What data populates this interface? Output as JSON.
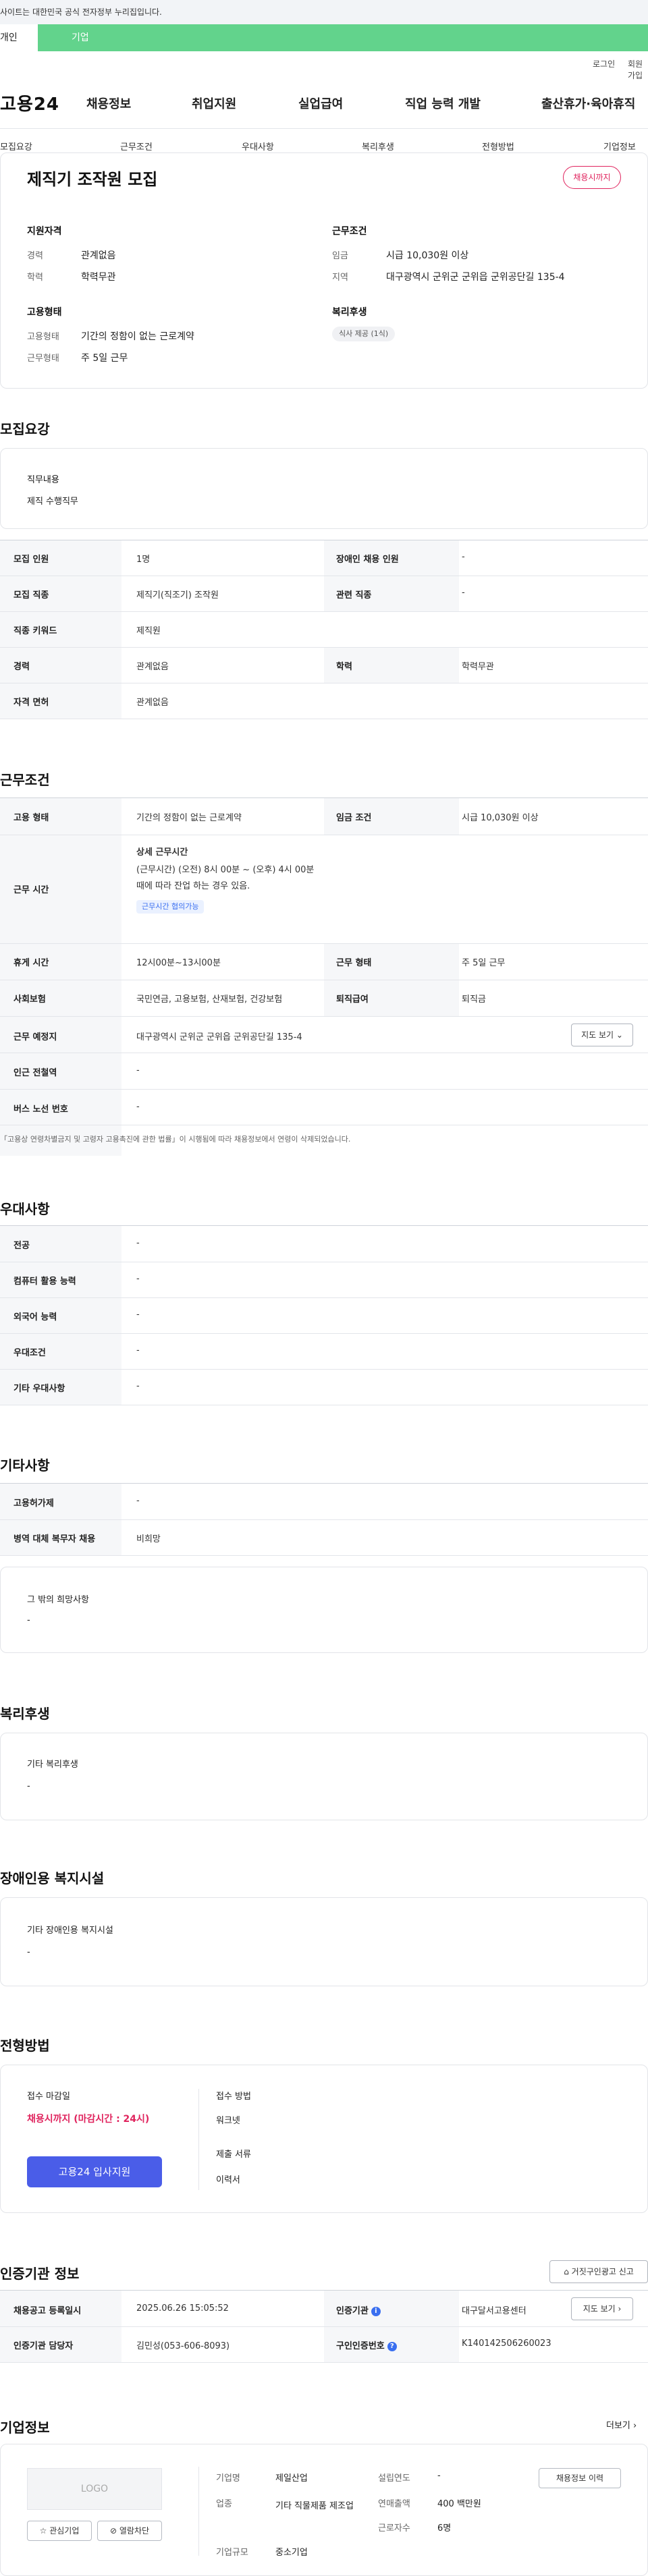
{
  "gov_bar": {
    "text": "사이트는 대한민국 공식 전자정부 누리집입니다."
  },
  "top_tabs": {
    "personal": "개인",
    "company": "기업"
  },
  "util": {
    "login": "로그인",
    "join": "회원가입"
  },
  "header": {
    "logo": "고용24",
    "gnb": [
      "채용정보",
      "취업지원",
      "실업급여",
      "직업 능력 개발",
      "출산휴가·육아휴직"
    ]
  },
  "subnav": [
    "모집요강",
    "근무조건",
    "우대사항",
    "복리후생",
    "전형방법",
    "기업정보"
  ],
  "summary": {
    "title": "제직기 조작원 모집",
    "status_badge": "채용시까지",
    "qual_heading": "지원자격",
    "qual": [
      {
        "label": "경력",
        "value": "관계없음"
      },
      {
        "label": "학력",
        "value": "학력무관"
      }
    ],
    "cond_heading": "근무조건",
    "cond": [
      {
        "label": "임금",
        "value": "시급 10,030원 이상"
      },
      {
        "label": "지역",
        "value": "대구광역시 군위군 군위읍 군위공단길 135-4"
      }
    ],
    "emp_heading": "고용형태",
    "emp": [
      {
        "label": "고용형태",
        "value": "기간의 정함이 없는 근로계약"
      },
      {
        "label": "근무형태",
        "value": "주 5일 근무"
      }
    ],
    "welfare_heading": "복리후생",
    "welfare_chip": "식사 제공 (1식)"
  },
  "recruit": {
    "heading": "모집요강",
    "duty_label": "직무내용",
    "duty_value": "제직 수행직무",
    "rows": [
      {
        "th1": "모집 인원",
        "td1": "1명",
        "th2": "장애인 채용 인원",
        "td2": "-"
      },
      {
        "th1": "모집 직종",
        "td1": "제직기(직조기) 조작원",
        "th2": "관련 직종",
        "td2": "-"
      },
      {
        "th1": "직종 키워드",
        "td1": "제직원"
      },
      {
        "th1": "경력",
        "td1": "관계없음",
        "th2": "학력",
        "td2": "학력무관"
      },
      {
        "th1": "자격 면허",
        "td1": "관계없음"
      }
    ]
  },
  "work": {
    "heading": "근무조건",
    "type_th": "고용 형태",
    "type_td": "기간의 정함이 없는 근로계약",
    "wage_th": "임금 조건",
    "wage_td": "시급 10,030원 이상",
    "time_th": "근무 시간",
    "time_lines": [
      "상세 근무시간",
      "(근무시간) (오전) 8시 00분 ~ (오후) 4시 00분",
      "때에 따라 잔업 하는 경우 있음."
    ],
    "time_tag": "근무시간 협의가능",
    "rest_th": "휴게 시간",
    "rest_td": "12시00분~13시00분",
    "shift_th": "근무 형태",
    "shift_td": "주 5일 근무",
    "ins_th": "사회보험",
    "ins_td": "국민연금, 고용보험, 산재보험, 건강보험",
    "sev_th": "퇴직급여",
    "sev_td": "퇴직금",
    "place_th": "근무 예정지",
    "place_td": "대구광역시 군위군 군위읍 군위공단길 135-4",
    "map_btn": "지도 보기",
    "station_th": "인근 전철역",
    "station_td": "-",
    "bus_th": "버스 노선 번호",
    "bus_td": "-",
    "note": "「고용상 연령차별금지 및 고령자 고용촉진에 관한 법률」이 시행됨에 따라 채용정보에서 연령이 삭제되었습니다."
  },
  "pref": {
    "heading": "우대사항",
    "rows": [
      {
        "th": "전공",
        "td": "-"
      },
      {
        "th": "컴퓨터 활용 능력",
        "td": "-"
      },
      {
        "th": "외국어 능력",
        "td": "-"
      },
      {
        "th": "우대조건",
        "td": "-"
      },
      {
        "th": "기타 우대사항",
        "td": "-"
      }
    ]
  },
  "etc": {
    "heading": "기타사항",
    "rows": [
      {
        "th": "고용허가제",
        "td": "-"
      },
      {
        "th": "병역 대체 복무자 채용",
        "td": "비희망"
      }
    ],
    "other_label": "그 밖의 희망사항",
    "other_value": "-"
  },
  "benefit": {
    "heading": "복리후생",
    "label": "기타 복리후생",
    "value": "-"
  },
  "facility": {
    "heading": "장애인용 복지시설",
    "label": "기타 장애인용 복지시설",
    "value": "-"
  },
  "screening": {
    "heading": "전형방법",
    "deadline_label": "접수 마감일",
    "deadline_value": "채용시까지 (마감시간 : 24시)",
    "apply_btn": "고용24 입사지원",
    "method_label": "접수 방법",
    "method_value": "워크넷",
    "docs_label": "제출 서류",
    "docs_value": "이력서"
  },
  "agency": {
    "heading": "인증기관 정보",
    "report_btn": "거짓구인광고 신고",
    "reg_th": "채용공고 등록일시",
    "reg_td": "2025.06.26 15:05:52",
    "org_th": "인증기관",
    "org_td": "대구달서고용센터",
    "map_btn": "지도 보기",
    "mgr_th": "인증기관 담당자",
    "mgr_td": "김민성(053-606-8093)",
    "num_th": "구인인증번호",
    "num_td": "K140142506260023"
  },
  "company": {
    "heading": "기업정보",
    "more": "더보기",
    "logo": "LOGO",
    "fav_btn": "관심기업",
    "block_btn": "열람차단",
    "history_btn": "채용정보 이력",
    "fields": [
      {
        "label": "기업명",
        "value": "제일산업"
      },
      {
        "label": "업종",
        "value": "기타 직물제품 제조업"
      },
      {
        "label": "기업규모",
        "value": "중소기업"
      }
    ],
    "fields2": [
      {
        "label": "설립연도",
        "value": "-"
      },
      {
        "label": "연매출액",
        "value": "400 백만원"
      },
      {
        "label": "근로자수",
        "value": "6명"
      }
    ]
  },
  "colors": {
    "accent": "#62d38c",
    "primary": "#4a5de8",
    "danger": "#e0245e"
  }
}
